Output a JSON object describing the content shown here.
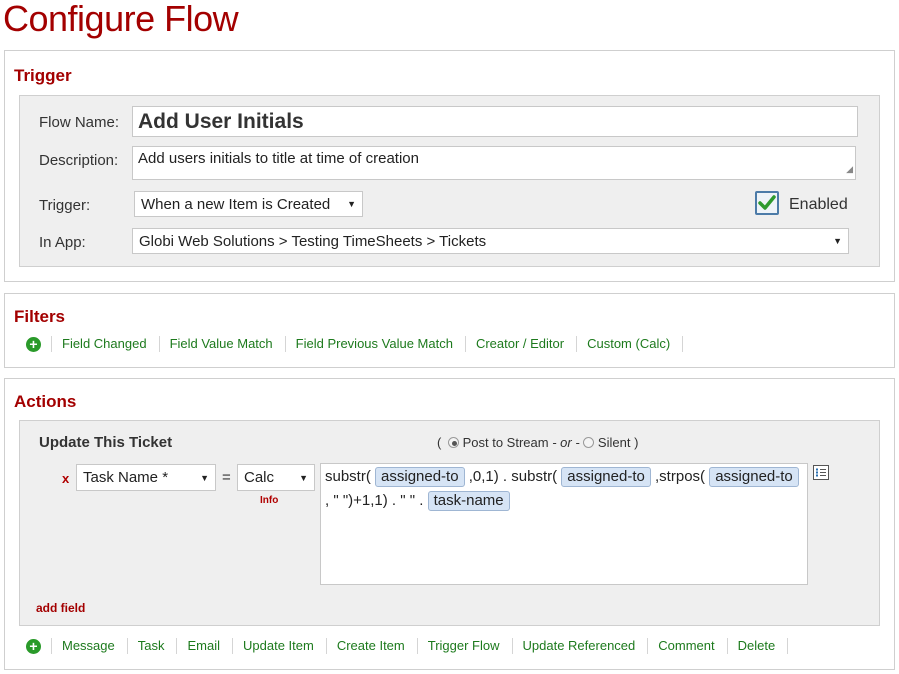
{
  "page": {
    "title": "Configure Flow"
  },
  "trigger": {
    "heading": "Trigger",
    "flow_name_label": "Flow Name:",
    "flow_name_value": "Add User Initials",
    "description_label": "Description:",
    "description_value": "Add users initials to title at time of creation",
    "trigger_label": "Trigger:",
    "trigger_value": "When a new Item is Created",
    "enabled_label": "Enabled",
    "enabled_checked": true,
    "in_app_label": "In App:",
    "in_app_value": "Globi Web Solutions > Testing TimeSheets > Tickets"
  },
  "filters": {
    "heading": "Filters",
    "links": [
      "Field Changed",
      "Field Value Match",
      "Field Previous Value Match",
      "Creator / Editor",
      "Custom (Calc)"
    ]
  },
  "actions": {
    "heading": "Actions",
    "action_title": "Update This Ticket",
    "post_mode": {
      "open_paren": "(",
      "post_to_stream_label": "Post to Stream",
      "or_text": "- or -",
      "silent_label": "Silent",
      "close_paren": ")",
      "selected": "Post to Stream"
    },
    "field_row": {
      "remove_label": "x",
      "field_select": "Task Name *",
      "equals": "=",
      "mode_select": "Calc",
      "info_label": "Info",
      "calc": {
        "t1": "substr(",
        "tok1": "assigned-to",
        "t2": ",0,1) . substr(",
        "tok2": "assigned-to",
        "t3": ",strpos(",
        "tok3": "assigned-to",
        "t4": ", \" \")+1,1) . \" \" .",
        "tok4": "task-name"
      }
    },
    "add_field_label": "add field",
    "links": [
      "Message",
      "Task",
      "Email",
      "Update Item",
      "Create Item",
      "Trigger Flow",
      "Update Referenced",
      "Comment",
      "Delete"
    ]
  },
  "colors": {
    "heading_red": "#a30000",
    "link_green": "#1d7a1d",
    "token_blue": "#d6e4f5"
  },
  "icons": {
    "add": "plus-circle-icon",
    "token_picker": "list-icon",
    "check": "checkmark-icon"
  }
}
